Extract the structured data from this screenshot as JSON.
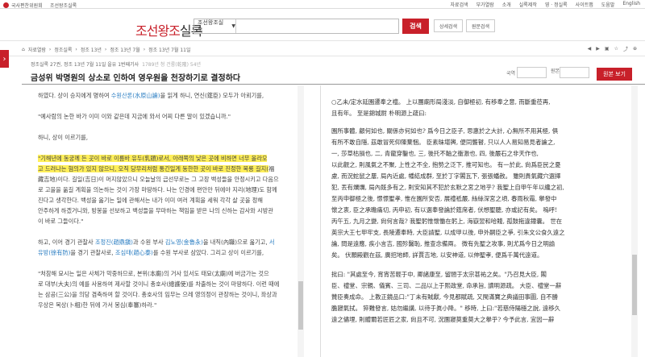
{
  "topbar": {
    "institute": "국사편찬위원회",
    "site": "조선왕조실록",
    "links": [
      "자료검색",
      "부가열람",
      "소개",
      "실록제작",
      "영 · 정실록",
      "사이트맵",
      "도움말",
      "English"
    ]
  },
  "header": {
    "logo_red": "조선왕조",
    "logo_dark": "실록",
    "search_select": "조선왕조실록",
    "search_placeholder": "",
    "search_button": "검색",
    "detail_search": "상세검색",
    "original_search": "원문검색"
  },
  "breadcrumb": {
    "items": [
      "자료열람",
      "정조실록",
      "정조 13년",
      "정조 13년 7월",
      "정조 13년 7월 11일"
    ]
  },
  "colors": {
    "accent": "#c8202a",
    "highlight": "#ffef5a",
    "person_link": "#2a7dc2",
    "place_link": "#2a8d3b"
  },
  "record": {
    "info": "정조실록 27권, 정조 13년 7월 11일 을유 1번째기사",
    "info_sub": "1789년 청 건륭(乾隆) 54년",
    "title": "금성위 박명원의 상소로 인하여 영우원을 천장하기로 결정하다",
    "guk_label": "국역",
    "wonbon_label": "원본",
    "view_button": "원본 보기"
  },
  "left_text": {
    "l1a": "하였다. 상이 승지에게 명하여 ",
    "l1b": "수원산론(水原山論)",
    "l1c": "을 읽게 하니, 연신(筵臣) 모두가 아뢰기를,",
    "l2": "\"예사람의 논한 바가 이미 이와 같은데 지금에 와서 어찌 다른 말이 있겠습니까.\"",
    "l3": "하니, 상이 이르기를,",
    "l4a": "\"기해년에 동궁께 든 곳이 바로 이름바 유두(乳頭)로서, 아래쪽의 낮은 곳에 비하면 너무 올라오",
    "l4b": "고 드러나는 혐의가 있지 않으니, 오직 당무리처럼 통긴일게 동한한 곳이 바로 진정한 복룡 길지(",
    "l4c": "福",
    "l4d": "藏吉地)이다. 길일(吉日)이 머지않았으니 오늘날의 급선무로는 그 고장 백성들을 안정시키고 다음으",
    "l4e": "로 고을을 옮길 계획을 의논하는 것이 가장 마땅하다. 나는 인경에 편안만 뒤에야 지리(地理)도 함께",
    "l4f": "진다고 생각한다. 백성을 옮기는 일에 관해서는 내가 이미 여러 계획을 세워 각각 살 곳을 정해",
    "l4g": "안주하게 하겠거니와, 방봉을 선보하고 백성들을 무마하는 책임을 받은 나의 신하는 감사와 시방관",
    "l4h": "이 바로 그들이다.\"",
    "l5a": "하고, 이어 경기 관찰사 ",
    "l5b": "조정진(趙鼎鎭)",
    "l5c": "과 수원 부사 ",
    "l5d": "김노영(金魯永)",
    "l5e": "을 내직(內職)으로 옮기고, ",
    "l5f": "서",
    "l5g": "유방(徐有防)",
    "l5h": "을 경기 관찰사로, ",
    "l5i": "조심태(趙心泰)",
    "l5j": "를 수원 부사로 삼았다. 그리고 상이 이르기를,",
    "l6a": "\"처참해 묘시는 일은 사체가 막중하므로, 본위(本廟)의 거사 있서도 태묘(太廟)에 버금가는 것으",
    "l6b": "로 대부(大夫)의 예를 사용하여 제사할 것이니 총호사(總護使)를 차출하는 것이 마땅하다. 이런 때에",
    "l6c": "는 삼공(三公)을 의당 겸축하여 할 것이다. 총호사의 임무는 으레 영의정이 관장하는 것이니, 좌상과",
    "l6d": "우상은 복상(卜相)한 뒤에 가서 봉심(奉審)하라.\""
  },
  "right_text": {
    "r1": "○乙未/定水延園遷奉之禮。 上以團廟形局淺淡, 自御極初, 有移奉之意, 而斷重莅再,",
    "r2": "且有年。 至是錦城尉 朴明源上疏曰:",
    "r3": "園所事體, 顧何如也, 關係亦何如也? 爲今日之臣子, 思惠於之大計, 心無所不用其極, 俱",
    "r4": "有所不敢自隱, 茲敢冒死仰陳棄悃。 臣素昧堪輿, 便同聾瞽, 只以人人易知易見者論之,",
    "r5": "一, 莎草枯損也, 二, 青龍穿鑿也, 三, 後托不軸之衝激也, 四, 後嚴石之非天作也,",
    "r6": "以此觀之, 則風氣之不聚, 上性之不全, 抱勢之泛下, 推可知也。 有一於此, 尙爲臣民之憂",
    "r7": "慮, 而況蛇鼠之屢, 局內近處, 幡結成群, 至於丁字閣瓦下, 張張蟠赦。 雖則貴氣藏穴選擇",
    "r8": "犯, 丟有爛爛, 局內既多有之, 則安知其不犯於玄默之宮之地乎? 我聖上自甲午年以纔之初,",
    "r9": "至丙申御極之後, 憬憬聖孝, 惟在園所安否, 展禮祗嚴, 絲絲深宮之頃, 春雨秋霜, 擧發中",
    "r10": "懷之衷, 臣之承瞻痛切, 丙申初, 有以選奉發論於筵席者, 伏想聖聽, 亦或記有矣。 嗚呼!",
    "r11": "丙午五, 九月之變, 尙何言哉? 我聖躬惟懷慟在躬上, 海嶽翌和哈賤, 孤鼓拖違鐘囊。 世在",
    "r12": "英宗大王七甲牢支, 長陵遷奉時, 大臣請聖, 以成甲以後, 申外嗣臣之爭, 引朱文公食久遠之",
    "r13": "論, 問是遠應, 疾小言吉, 國殄醫恥, 推查念備兩。 微有先聖之攻事, 則尤爲今日之明諭",
    "r14": "矣。 伏願殿觀在茲, 廣招地師, 詳賈吉地, 以安神道, 以伸聖孝, 便爲千萬代遠道。",
    "r15": "批曰: \"其處至今, 宵宵苦輕于中, 卿諸康至, 留閤于太宗甚祐之矣。\"乃召見大臣, 閣",
    "r16": "臣、禮堂、宗親、儀賓、三司、二品以上于熙政堂, 命承旨, 讀明源疏。 大臣、禮堂一辭",
    "r17": "贊臣奏成命。 上教正鏡品口:\"丁未有賊獻, 今見都賦疏, 又閩滿寶之典議田事圖, 自不勝",
    "r18": "膽寢氣拭。 猝難發言, 姑勿繼講, 以待于眞小降。\" 移時, 上曰:\"若慈侍陽穩之說, 遠移久",
    "r19": "遠之儘埋, 則體爾若匠匠之家, 尙且不可, 況團寢莫重莫大之擧乎? 今予此言, 宜因一辭"
  }
}
